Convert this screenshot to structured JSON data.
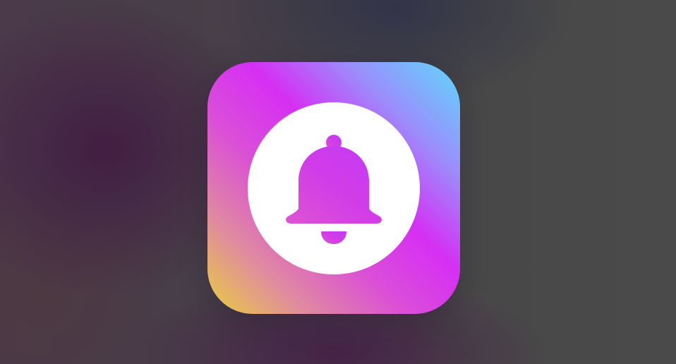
{
  "app_icon": {
    "icon_name": "bell-icon",
    "gradient_colors": [
      "#5ed8fb",
      "#9a8ffc",
      "#d62ff4",
      "#da4ed8",
      "#e08aa0",
      "#e9cf3c"
    ],
    "badge_color": "#ffffff",
    "glyph_color": "#d63cf0"
  },
  "background": {
    "base_color": "#474748",
    "tint_color": "#421c42"
  }
}
